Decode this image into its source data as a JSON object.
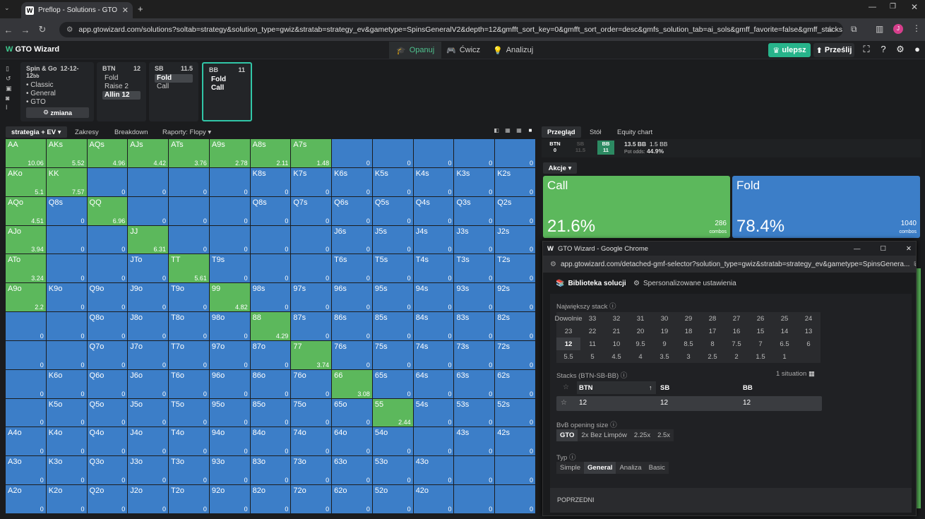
{
  "browser": {
    "tab_title": "Preflop - Solutions - GTO Wizar",
    "favicon": "W",
    "url": "app.gtowizard.com/solutions?soltab=strategy&solution_type=gwiz&stratab=strategy_ev&gametype=SpinsGeneralV2&depth=12&gmfft_sort_key=0&gmfft_sort_order=desc&gmfs_solution_tab=ai_sols&gmff_favorite=false&gmff_stacks_type=S...",
    "avatar": "J"
  },
  "header": {
    "brand": "GTO Wizard",
    "nav": [
      {
        "label": "Opanuj"
      },
      {
        "label": "Ćwicz"
      },
      {
        "label": "Analizuj"
      }
    ],
    "upgrade": "ulepsz",
    "upload": "Prześlij"
  },
  "config": {
    "title": "Spin & Go",
    "stacks": "12-12-12",
    "unit": "bb",
    "items": [
      "• Classic",
      "• General",
      "• GTO"
    ],
    "change": "zmiana"
  },
  "seats": [
    {
      "pos": "BTN",
      "stack": "12",
      "actions": [
        "Fold",
        "Raise 2",
        "Allin 12"
      ],
      "selected": 2
    },
    {
      "pos": "SB",
      "stack": "11.5",
      "actions": [
        "Fold",
        "Call"
      ],
      "selected": 0
    },
    {
      "pos": "BB",
      "stack": "11",
      "actions": [
        "Fold",
        "Call"
      ],
      "selected": -1
    }
  ],
  "subtabs": [
    "strategia + EV",
    "Zakresy",
    "Breakdown",
    "Raporty: Flopy"
  ],
  "right_tabs": [
    "Przegląd",
    "Stół",
    "Equity chart"
  ],
  "pot": {
    "btn": "BTN",
    "btn_v": "0",
    "sb": "SB",
    "sb_v": "11.5",
    "bb": "BB",
    "bb_v": "11",
    "total": "13.5 BB",
    "call": "1.5 BB",
    "odds_label": "Pot odds:",
    "odds": "44.9%"
  },
  "actions_label": "Akcje",
  "actions": [
    {
      "name": "Call",
      "pct": "21.6%",
      "combos": "286",
      "unit": "combos",
      "color": "#5cb85c"
    },
    {
      "name": "Fold",
      "pct": "78.4%",
      "combos": "1040",
      "unit": "combos",
      "color": "#3c7ec8"
    }
  ],
  "grid": [
    [
      [
        "AA",
        "10.06",
        1
      ],
      [
        "AKs",
        "5.52",
        1
      ],
      [
        "AQs",
        "4.96",
        1
      ],
      [
        "AJs",
        "4.42",
        1
      ],
      [
        "ATs",
        "3.76",
        1
      ],
      [
        "A9s",
        "2.78",
        1
      ],
      [
        "A8s",
        "2.11",
        1
      ],
      [
        "A7s",
        "1.48",
        1
      ],
      [
        "",
        "0",
        0
      ],
      [
        "",
        "0",
        0
      ],
      [
        "",
        "0",
        0
      ],
      [
        "",
        "0",
        0
      ],
      [
        "",
        "0",
        0
      ]
    ],
    [
      [
        "AKo",
        "5.1",
        1
      ],
      [
        "KK",
        "7.57",
        1
      ],
      [
        "",
        "0",
        0
      ],
      [
        "",
        "0",
        0
      ],
      [
        "",
        "0",
        0
      ],
      [
        "",
        "0",
        0
      ],
      [
        "K8s",
        "0",
        0
      ],
      [
        "K7s",
        "0",
        0
      ],
      [
        "K6s",
        "0",
        0
      ],
      [
        "K5s",
        "0",
        0
      ],
      [
        "K4s",
        "0",
        0
      ],
      [
        "K3s",
        "0",
        0
      ],
      [
        "K2s",
        "0",
        0
      ]
    ],
    [
      [
        "AQo",
        "4.51",
        1
      ],
      [
        "Q8s",
        "0",
        0
      ],
      [
        "QQ",
        "6.96",
        1
      ],
      [
        "",
        "0",
        0
      ],
      [
        "",
        "0",
        0
      ],
      [
        "",
        "0",
        0
      ],
      [
        "Q8s",
        "0",
        0
      ],
      [
        "Q7s",
        "0",
        0
      ],
      [
        "Q6s",
        "0",
        0
      ],
      [
        "Q5s",
        "0",
        0
      ],
      [
        "Q4s",
        "0",
        0
      ],
      [
        "Q3s",
        "0",
        0
      ],
      [
        "Q2s",
        "0",
        0
      ]
    ],
    [
      [
        "AJo",
        "3.94",
        1
      ],
      [
        "",
        "0",
        0
      ],
      [
        "",
        "0",
        0
      ],
      [
        "JJ",
        "6.31",
        1
      ],
      [
        "",
        "0",
        0
      ],
      [
        "",
        "0",
        0
      ],
      [
        "",
        "0",
        0
      ],
      [
        "",
        "0",
        0
      ],
      [
        "J6s",
        "0",
        0
      ],
      [
        "J5s",
        "0",
        0
      ],
      [
        "J4s",
        "0",
        0
      ],
      [
        "J3s",
        "0",
        0
      ],
      [
        "J2s",
        "0",
        0
      ]
    ],
    [
      [
        "ATo",
        "3.24",
        1
      ],
      [
        "",
        "0",
        0
      ],
      [
        "",
        "0",
        0
      ],
      [
        "JTo",
        "0",
        0
      ],
      [
        "TT",
        "5.61",
        1
      ],
      [
        "T9s",
        "0",
        0
      ],
      [
        "",
        "0",
        0
      ],
      [
        "",
        "0",
        0
      ],
      [
        "T6s",
        "0",
        0
      ],
      [
        "T5s",
        "0",
        0
      ],
      [
        "T4s",
        "0",
        0
      ],
      [
        "T3s",
        "0",
        0
      ],
      [
        "T2s",
        "0",
        0
      ]
    ],
    [
      [
        "A9o",
        "2.2",
        1
      ],
      [
        "K9o",
        "0",
        0
      ],
      [
        "Q9o",
        "0",
        0
      ],
      [
        "J9o",
        "0",
        0
      ],
      [
        "T9o",
        "0",
        0
      ],
      [
        "99",
        "4.82",
        1
      ],
      [
        "98s",
        "0",
        0
      ],
      [
        "97s",
        "0",
        0
      ],
      [
        "96s",
        "0",
        0
      ],
      [
        "95s",
        "0",
        0
      ],
      [
        "94s",
        "0",
        0
      ],
      [
        "93s",
        "0",
        0
      ],
      [
        "92s",
        "0",
        0
      ]
    ],
    [
      [
        "",
        "0",
        0
      ],
      [
        "",
        "0",
        0
      ],
      [
        "Q8o",
        "0",
        0
      ],
      [
        "J8o",
        "0",
        0
      ],
      [
        "T8o",
        "0",
        0
      ],
      [
        "98o",
        "0",
        0
      ],
      [
        "88",
        "4.29",
        1
      ],
      [
        "87s",
        "0",
        0
      ],
      [
        "86s",
        "0",
        0
      ],
      [
        "85s",
        "0",
        0
      ],
      [
        "84s",
        "0",
        0
      ],
      [
        "83s",
        "0",
        0
      ],
      [
        "82s",
        "0",
        0
      ]
    ],
    [
      [
        "",
        "0",
        0
      ],
      [
        "",
        "0",
        0
      ],
      [
        "Q7o",
        "0",
        0
      ],
      [
        "J7o",
        "0",
        0
      ],
      [
        "T7o",
        "0",
        0
      ],
      [
        "97o",
        "0",
        0
      ],
      [
        "87o",
        "0",
        0
      ],
      [
        "77",
        "3.74",
        1
      ],
      [
        "76s",
        "0",
        0
      ],
      [
        "75s",
        "0",
        0
      ],
      [
        "74s",
        "0",
        0
      ],
      [
        "73s",
        "0",
        0
      ],
      [
        "72s",
        "0",
        0
      ]
    ],
    [
      [
        "",
        "0",
        0
      ],
      [
        "K6o",
        "0",
        0
      ],
      [
        "Q6o",
        "0",
        0
      ],
      [
        "J6o",
        "0",
        0
      ],
      [
        "T6o",
        "0",
        0
      ],
      [
        "96o",
        "0",
        0
      ],
      [
        "86o",
        "0",
        0
      ],
      [
        "76o",
        "0",
        0
      ],
      [
        "66",
        "3.08",
        1
      ],
      [
        "65s",
        "0",
        0
      ],
      [
        "64s",
        "0",
        0
      ],
      [
        "63s",
        "0",
        0
      ],
      [
        "62s",
        "0",
        0
      ]
    ],
    [
      [
        "",
        "0",
        0
      ],
      [
        "K5o",
        "0",
        0
      ],
      [
        "Q5o",
        "0",
        0
      ],
      [
        "J5o",
        "0",
        0
      ],
      [
        "T5o",
        "0",
        0
      ],
      [
        "95o",
        "0",
        0
      ],
      [
        "85o",
        "0",
        0
      ],
      [
        "75o",
        "0",
        0
      ],
      [
        "65o",
        "0",
        0
      ],
      [
        "55",
        "2.44",
        1
      ],
      [
        "54s",
        "0",
        0
      ],
      [
        "53s",
        "0",
        0
      ],
      [
        "52s",
        "0",
        0
      ]
    ],
    [
      [
        "A4o",
        "0",
        0
      ],
      [
        "K4o",
        "0",
        0
      ],
      [
        "Q4o",
        "0",
        0
      ],
      [
        "J4o",
        "0",
        0
      ],
      [
        "T4o",
        "0",
        0
      ],
      [
        "94o",
        "0",
        0
      ],
      [
        "84o",
        "0",
        0
      ],
      [
        "74o",
        "0",
        0
      ],
      [
        "64o",
        "0",
        0
      ],
      [
        "54o",
        "0",
        0
      ],
      [
        "",
        "0",
        0
      ],
      [
        "43s",
        "0",
        0
      ],
      [
        "42s",
        "0",
        0
      ]
    ],
    [
      [
        "A3o",
        "0",
        0
      ],
      [
        "K3o",
        "0",
        0
      ],
      [
        "Q3o",
        "0",
        0
      ],
      [
        "J3o",
        "0",
        0
      ],
      [
        "T3o",
        "0",
        0
      ],
      [
        "93o",
        "0",
        0
      ],
      [
        "83o",
        "0",
        0
      ],
      [
        "73o",
        "0",
        0
      ],
      [
        "63o",
        "0",
        0
      ],
      [
        "53o",
        "0",
        0
      ],
      [
        "43o",
        "0",
        0
      ],
      [
        "",
        "0",
        0
      ],
      [
        "",
        "0",
        0
      ]
    ],
    [
      [
        "A2o",
        "0",
        0
      ],
      [
        "K2o",
        "0",
        0
      ],
      [
        "Q2o",
        "0",
        0
      ],
      [
        "J2o",
        "0",
        0
      ],
      [
        "T2o",
        "0",
        0
      ],
      [
        "92o",
        "0",
        0
      ],
      [
        "82o",
        "0",
        0
      ],
      [
        "72o",
        "0",
        0
      ],
      [
        "62o",
        "0",
        0
      ],
      [
        "52o",
        "0",
        0
      ],
      [
        "42o",
        "0",
        0
      ],
      [
        "",
        "0",
        0
      ],
      [
        "",
        "0",
        0
      ]
    ]
  ],
  "popup": {
    "title": "GTO Wizard - Google Chrome",
    "favicon": "W",
    "url": "app.gtowizard.com/detached-gmf-selector?solution_type=gwiz&stratab=strategy_ev&gametype=SpinsGenera...",
    "tabs": [
      "Biblioteka solucji",
      "Spersonalizowane ustawienia"
    ],
    "stack_label": "Największy stack",
    "stacks": [
      "Dowolnie",
      "33",
      "32",
      "31",
      "30",
      "29",
      "28",
      "27",
      "26",
      "25",
      "24",
      "23",
      "22",
      "21",
      "20",
      "19",
      "18",
      "17",
      "16",
      "15",
      "14",
      "13",
      "12",
      "11",
      "10",
      "9.5",
      "9",
      "8.5",
      "8",
      "7.5",
      "7",
      "6.5",
      "6",
      "5.5",
      "5",
      "4.5",
      "4",
      "3.5",
      "3",
      "2.5",
      "2",
      "1.5",
      "1"
    ],
    "stack_selected": "12",
    "stacks_label": "Stacks (BTN-SB-BB)",
    "situation": "1 situation",
    "cols": [
      "BTN",
      "SB",
      "BB"
    ],
    "vals": [
      "12",
      "12",
      "12"
    ],
    "bvb_label": "BvB opening size",
    "bvb": [
      "GTO",
      "2x Bez Limpów",
      "2.25x",
      "2.5x"
    ],
    "bvb_sel": 0,
    "type_label": "Typ",
    "types": [
      "Simple",
      "General",
      "Analiza",
      "Basic"
    ],
    "type_sel": 1,
    "prev": "POPRZEDNI"
  }
}
